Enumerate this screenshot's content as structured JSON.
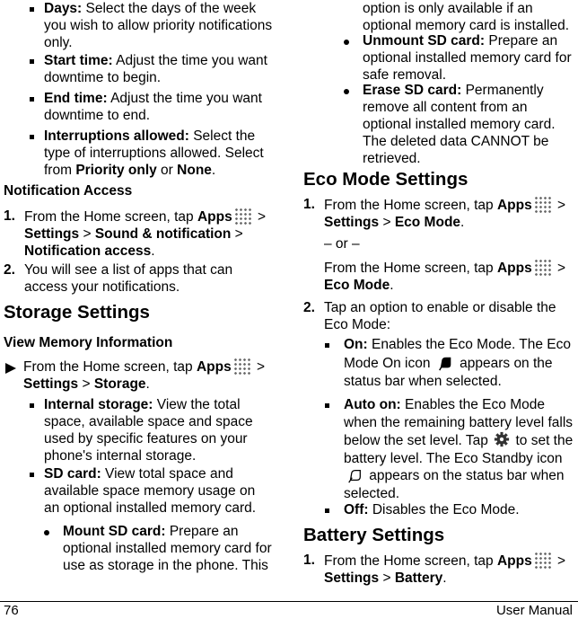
{
  "left": {
    "downtime_items": [
      {
        "label": "Days:",
        "text": " Select the days of the week you wish to allow priority notifications only."
      },
      {
        "label": "Start time:",
        "text": " Adjust the time you want downtime to begin."
      },
      {
        "label": "End time:",
        "text": " Adjust the time you want downtime to end."
      },
      {
        "label": "Interruptions allowed:",
        "text": " Select the type of interruptions allowed. Select from ",
        "opt1": "Priority only",
        "mid": " or ",
        "opt2": "None",
        "end": "."
      }
    ],
    "notification_access": {
      "heading": "Notification Access",
      "steps": [
        {
          "num": "1.",
          "pre": "From the Home screen, tap ",
          "apps": "Apps",
          "gt1": " > ",
          "s1": "Settings",
          "gt2": " > ",
          "s2": "Sound & notification",
          "gt3": " > ",
          "s3": "Notification access",
          "end": "."
        },
        {
          "num": "2.",
          "text": "You will see a list of apps that can access your notifications."
        }
      ]
    },
    "storage": {
      "heading": "Storage Settings",
      "subheading": "View Memory Information",
      "step": {
        "pre": "From the Home screen, tap ",
        "apps": "Apps",
        "gt1": " > ",
        "s1": "Settings",
        "gt2": " > ",
        "s2": "Storage",
        "end": "."
      },
      "items": [
        {
          "label": "Internal storage:",
          "text": " View the total space, available space and space used by specific features on your phone's internal storage."
        },
        {
          "label": "SD card:",
          "text": " View total space and available space memory usage on an optional installed memory card."
        }
      ],
      "sub_items": [
        {
          "label": "Mount SD card:",
          "text": " Prepare an optional installed memory card for use as storage in the phone. This option is only available if an optional memory card is installed."
        },
        {
          "label": "Unmount SD card:",
          "text": " Prepare an optional installed memory card for safe removal."
        },
        {
          "label": "Erase SD card:",
          "text": " Permanently remove all content from an optional installed memory card. The deleted data CANNOT be retrieved."
        }
      ]
    }
  },
  "right": {
    "mount_continued": "option is only available if an optional memory card is installed.",
    "eco": {
      "heading": "Eco Mode Settings",
      "step1": {
        "num": "1.",
        "pre": "From the Home screen, tap ",
        "apps": "Apps",
        "gt1": " > ",
        "s1": "Settings",
        "gt2": " > ",
        "s2": "Eco Mode",
        "end": "."
      },
      "or": "– or –",
      "alt": {
        "pre": "From the Home screen, tap ",
        "apps": "Apps",
        "gt1": " > ",
        "s1": "Eco Mode",
        "end": "."
      },
      "step2": {
        "num": "2.",
        "text": "Tap an option to enable or disable the Eco Mode:"
      },
      "options": [
        {
          "label": "On:",
          "text1": " Enables the Eco Mode. The Eco Mode On icon ",
          "text2": " appears on the status bar when selected."
        },
        {
          "label": "Auto on:",
          "text1": " Enables the Eco Mode when the remaining battery level falls below the set level. Tap ",
          "text2": " to set the battery level. The Eco Standby icon ",
          "text3": " appears on the status bar when selected."
        },
        {
          "label": "Off:",
          "text1": " Disables the Eco Mode."
        }
      ]
    },
    "battery": {
      "heading": "Battery Settings",
      "step1": {
        "num": "1.",
        "pre": "From the Home screen, tap ",
        "apps": "Apps",
        "gt1": " > ",
        "s1": "Settings",
        "gt2": " > ",
        "s2": "Battery",
        "end": "."
      }
    }
  },
  "footer": {
    "page_number": "76",
    "title": "User Manual"
  }
}
